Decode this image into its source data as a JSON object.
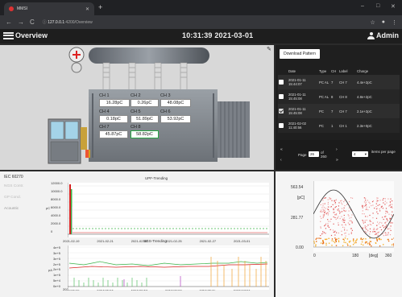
{
  "browser": {
    "tab_title": "MMSI",
    "url_host": "127.0.0.1",
    "url_path": ":4200/Overview",
    "url_prefix": "i"
  },
  "header": {
    "menu_label": "Overview",
    "datetime": "10:31:39 2021-03-01",
    "user_label": "Admin"
  },
  "channels": [
    {
      "label": "CH 1",
      "value": "16.28pC"
    },
    {
      "label": "CH 2",
      "value": "0.26pC"
    },
    {
      "label": "CH 3",
      "value": "48.08pC"
    },
    {
      "label": "CH 4",
      "value": "0.18pC"
    },
    {
      "label": "CH 5",
      "value": "51.89pC"
    },
    {
      "label": "CH 6",
      "value": "53.92pC"
    },
    {
      "label": "CH 7",
      "value": "45.87pC"
    },
    {
      "label": "CH 8",
      "value": "58.82pC"
    }
  ],
  "download": {
    "button_label": "Download Pattern",
    "columns": [
      "Date",
      "Type",
      "CH",
      "Label",
      "Charge"
    ],
    "rows": [
      {
        "date": "2021-01-11 15:44:07",
        "type": "PC AL",
        "ch": "7",
        "label": "CH 7",
        "charge": "4.4e+2pC",
        "checked": false
      },
      {
        "date": "2021-01-11 15:45:08",
        "type": "PC AL",
        "ch": "8",
        "label": "CH 8",
        "charge": "4.8e+2pC",
        "checked": false
      },
      {
        "date": "2021-01-11 15:45:08",
        "type": "PC",
        "ch": "7",
        "label": "CH 7",
        "charge": "2.1e+2pC",
        "checked": true
      },
      {
        "date": "2021-02-02 11:40:56",
        "type": "PC",
        "ch": "1",
        "label": "CH 1",
        "charge": "2.3e+0pC",
        "checked": false
      }
    ],
    "pager": {
      "page_label": "Page",
      "page_value": "26",
      "of_label": "of 260",
      "items_value": "4",
      "items_label": "items per page"
    }
  },
  "sidenav": {
    "title": "IEC 60270",
    "items": [
      "NGS Contr.",
      "GP Cond.",
      "Acoustic"
    ]
  },
  "upf_chart": {
    "title": "UPF-Trending",
    "ylabel": "pC",
    "y_ticks": [
      "12000.0",
      "10000.0",
      "8000.0",
      "6000.0",
      "4000.0",
      "2000.0",
      "0"
    ],
    "x_ticks": [
      "2021-02-19",
      "2021-02-21",
      "2021-02-23",
      "2021-02-25",
      "2021-02-27",
      "2021-03-01"
    ]
  },
  "ngs_chart": {
    "title": "NGS-Trending",
    "ylabel": "pA",
    "y_ticks": [
      "4e+5",
      "3e+5",
      "3e+5",
      "2e+5",
      "2e+5",
      "1e+5",
      "5e+4",
      "0e+0"
    ],
    "x_ticks": [
      "2021-02-19",
      "2021-02-21",
      "2021-02-23",
      "2021-02-25",
      "2021-02-27",
      "2021-03-01"
    ]
  },
  "prpd": {
    "y_ticks": [
      "563.54",
      "281.77",
      "0.00"
    ],
    "ylabel": "[pC]",
    "x_ticks": [
      "0",
      "180",
      "[deg]",
      "360"
    ]
  },
  "colors": {
    "highlight_green": "#28a745",
    "trend_red": "#d62020",
    "trend_green": "#3bb54a",
    "trend_orange": "#f0a030"
  }
}
